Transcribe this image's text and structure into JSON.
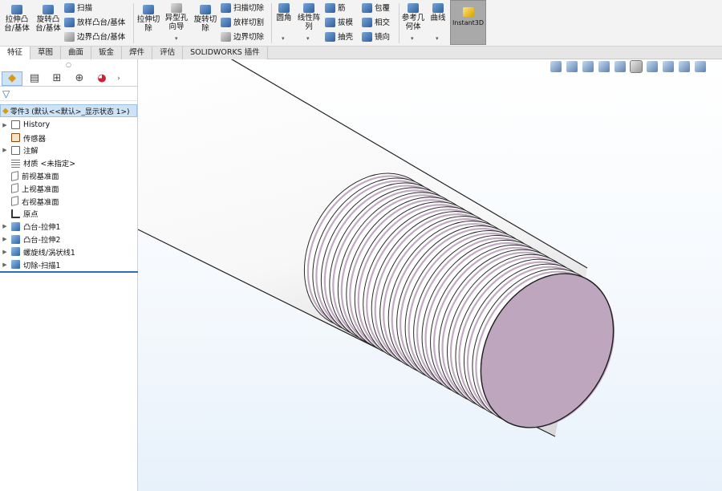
{
  "ribbon": {
    "extrude_boss": "拉伸凸台/基体",
    "revolve_boss": "旋转凸台/基体",
    "sweep": "扫描",
    "loft_boss": "放样凸台/基体",
    "boundary_boss": "边界凸台/基体",
    "extrude_cut": "拉伸切除",
    "hole_wizard": "异型孔向导",
    "revolve_cut": "旋转切除",
    "swept_cut": "扫描切除",
    "lofted_cut": "放样切割",
    "boundary_cut": "边界切除",
    "fillet": "圆角",
    "linear_pattern": "线性阵列",
    "rib": "筋",
    "draft": "拔模",
    "shell": "抽壳",
    "wrap": "包覆",
    "intersect": "相交",
    "mirror": "镜向",
    "reference_geometry": "参考几何体",
    "curves": "曲线",
    "instant3d": "Instant3D"
  },
  "tabs": [
    {
      "label": "特征",
      "active": true
    },
    {
      "label": "草图",
      "active": false
    },
    {
      "label": "曲面",
      "active": false
    },
    {
      "label": "钣金",
      "active": false
    },
    {
      "label": "焊件",
      "active": false
    },
    {
      "label": "评估",
      "active": false
    },
    {
      "label": "SOLIDWORKS 插件",
      "active": false
    }
  ],
  "tree": {
    "part": "零件3  (默认<<默认>_显示状态 1>)",
    "items": [
      {
        "label": "History",
        "icon": "history-icon",
        "expandable": true
      },
      {
        "label": "传感器",
        "icon": "sensor-icon",
        "expandable": false
      },
      {
        "label": "注解",
        "icon": "annotation-icon",
        "expandable": true
      },
      {
        "label": "材质 <未指定>",
        "icon": "material-icon",
        "expandable": false
      },
      {
        "label": "前视基准面",
        "icon": "plane-icon",
        "expandable": false
      },
      {
        "label": "上视基准面",
        "icon": "plane-icon",
        "expandable": false
      },
      {
        "label": "右视基准面",
        "icon": "plane-icon",
        "expandable": false
      },
      {
        "label": "原点",
        "icon": "origin-icon",
        "expandable": false
      },
      {
        "label": "凸台-拉伸1",
        "icon": "boss-extrude-icon",
        "expandable": true
      },
      {
        "label": "凸台-拉伸2",
        "icon": "boss-extrude-icon",
        "expandable": true
      },
      {
        "label": "螺旋线/涡状线1",
        "icon": "helix-icon",
        "expandable": true
      },
      {
        "label": "切除-扫描1",
        "icon": "cut-sweep-icon",
        "expandable": true
      }
    ]
  },
  "colors": {
    "thread_face": "#c0a9c1",
    "ribbon_bg": "#f3f3f3",
    "selection": "#cfe3f7"
  }
}
